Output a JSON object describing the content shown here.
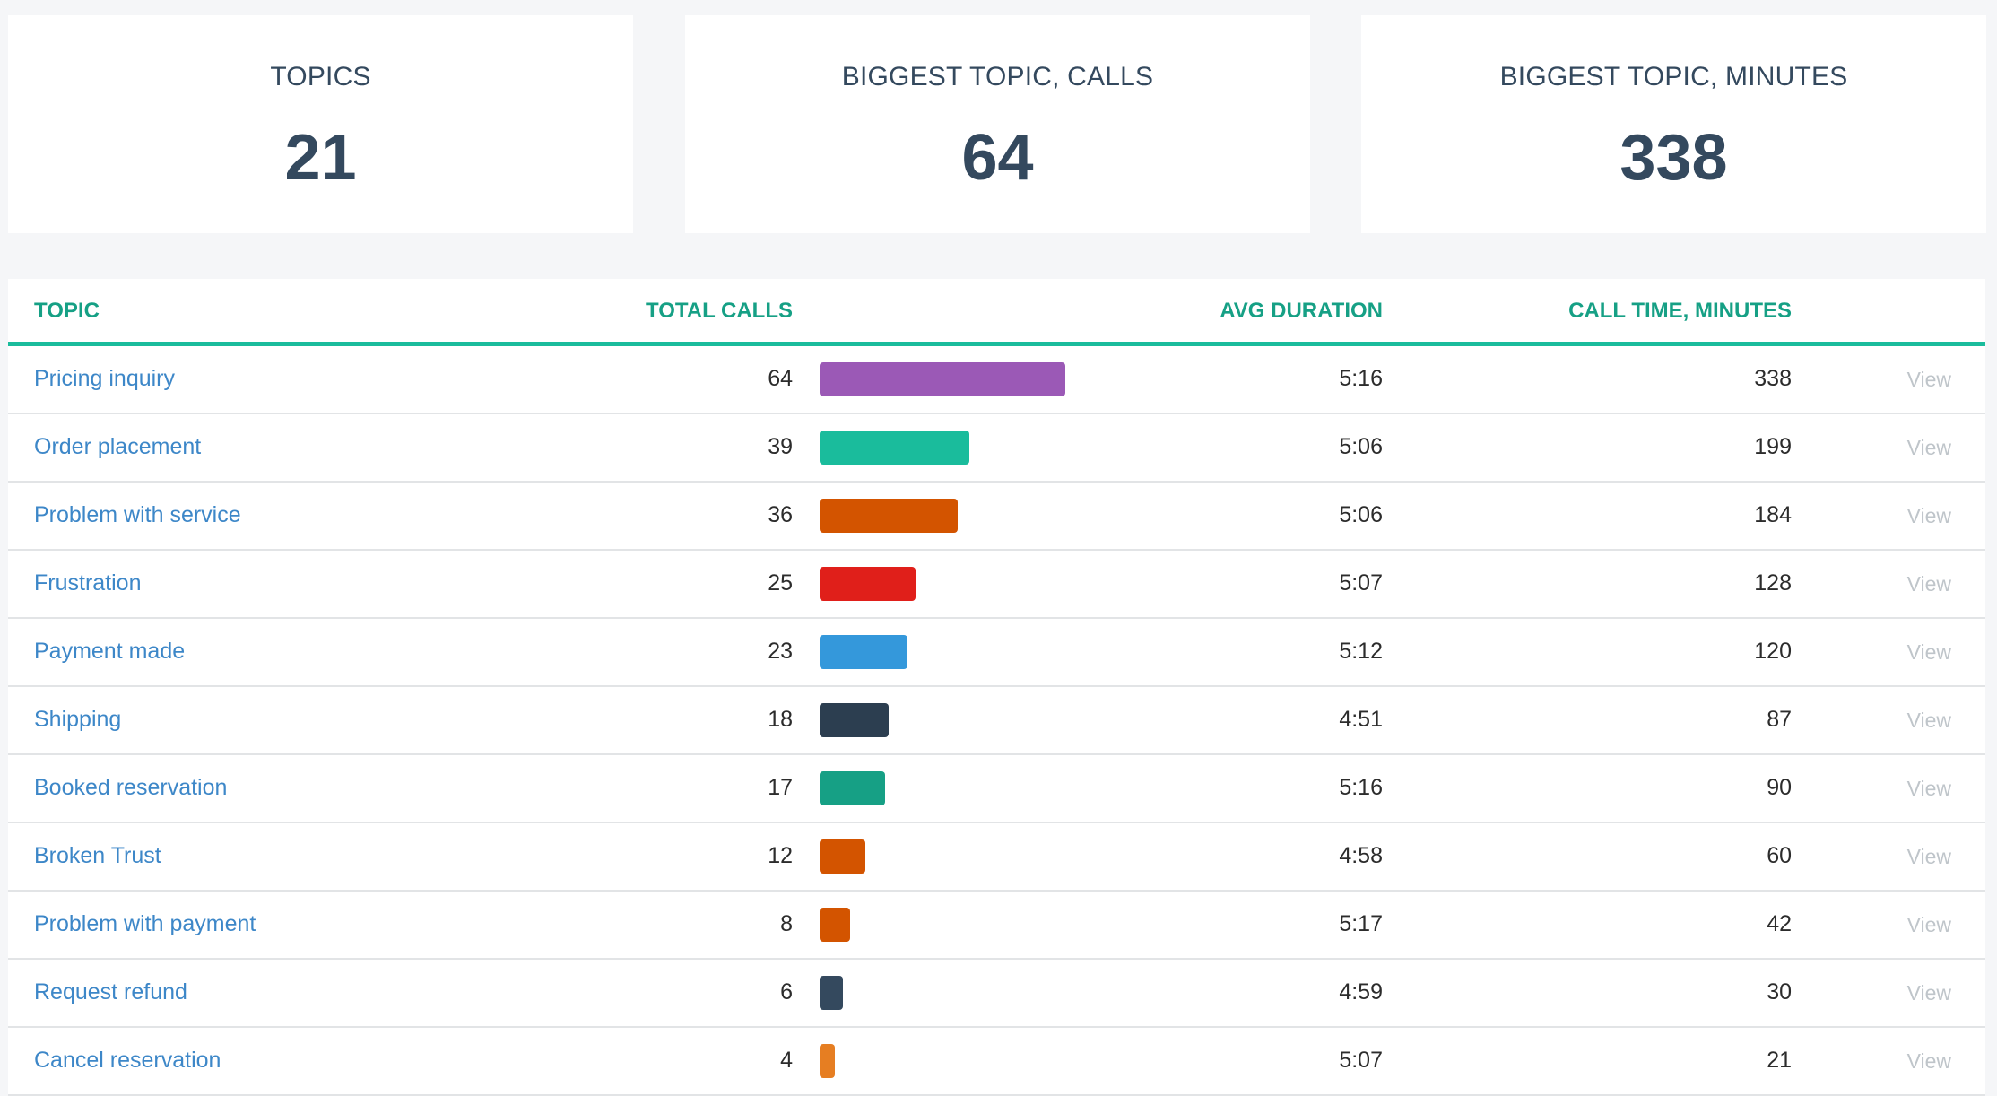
{
  "stats": [
    {
      "label": "TOPICS",
      "value": "21"
    },
    {
      "label": "BIGGEST TOPIC, CALLS",
      "value": "64"
    },
    {
      "label": "BIGGEST TOPIC, MINUTES",
      "value": "338"
    }
  ],
  "table": {
    "headers": {
      "topic": "TOPIC",
      "total_calls": "TOTAL CALLS",
      "avg_duration": "AVG DURATION",
      "call_time": "CALL TIME, MINUTES"
    },
    "max_calls": 64,
    "rows": [
      {
        "topic": "Pricing inquiry",
        "calls": 64,
        "color": "#9b59b6",
        "avg_duration": "5:16",
        "minutes": "338",
        "action": "View"
      },
      {
        "topic": "Order placement",
        "calls": 39,
        "color": "#1abc9c",
        "avg_duration": "5:06",
        "minutes": "199",
        "action": "View"
      },
      {
        "topic": "Problem with service",
        "calls": 36,
        "color": "#d35400",
        "avg_duration": "5:06",
        "minutes": "184",
        "action": "View"
      },
      {
        "topic": "Frustration",
        "calls": 25,
        "color": "#e01f1a",
        "avg_duration": "5:07",
        "minutes": "128",
        "action": "View"
      },
      {
        "topic": "Payment made",
        "calls": 23,
        "color": "#3498db",
        "avg_duration": "5:12",
        "minutes": "120",
        "action": "View"
      },
      {
        "topic": "Shipping",
        "calls": 18,
        "color": "#2c3e50",
        "avg_duration": "4:51",
        "minutes": "87",
        "action": "View"
      },
      {
        "topic": "Booked reservation",
        "calls": 17,
        "color": "#16a085",
        "avg_duration": "5:16",
        "minutes": "90",
        "action": "View"
      },
      {
        "topic": "Broken Trust",
        "calls": 12,
        "color": "#d35400",
        "avg_duration": "4:58",
        "minutes": "60",
        "action": "View"
      },
      {
        "topic": "Problem with payment",
        "calls": 8,
        "color": "#d35400",
        "avg_duration": "5:17",
        "minutes": "42",
        "action": "View"
      },
      {
        "topic": "Request refund",
        "calls": 6,
        "color": "#34495e",
        "avg_duration": "4:59",
        "minutes": "30",
        "action": "View"
      },
      {
        "topic": "Cancel reservation",
        "calls": 4,
        "color": "#e67e22",
        "avg_duration": "5:07",
        "minutes": "21",
        "action": "View"
      }
    ]
  }
}
